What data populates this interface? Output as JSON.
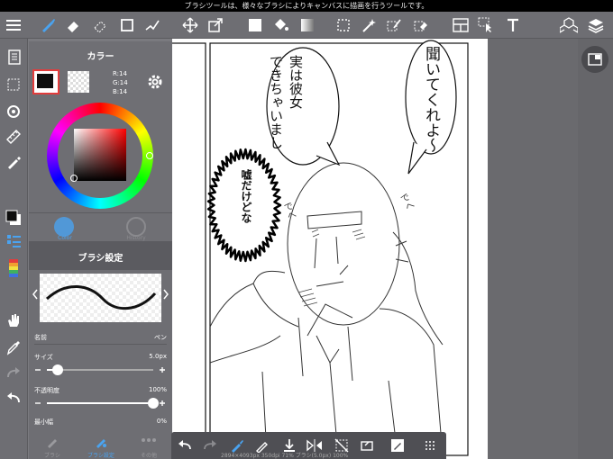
{
  "status_bar": {
    "hint": "ブラシツールは、様々なブラシによりキャンバスに描画を行うツールです。"
  },
  "color_panel": {
    "title": "カラー",
    "rgb": {
      "r": "R:14",
      "g": "G:14",
      "b": "B:14"
    },
    "tabs": [
      "Color",
      "History"
    ]
  },
  "brush_panel": {
    "title": "ブラシ設定",
    "name_label": "名前",
    "name_value": "ペン",
    "size_label": "サイズ",
    "size_value": "5.0px",
    "opacity_label": "不透明度",
    "opacity_value": "100%",
    "min_width_label": "最小幅",
    "min_width_value": "0%",
    "size_level": 0.1,
    "opacity_level": 1.0,
    "bottom_tabs": [
      "ブラシ",
      "ブラシ設定",
      "その他"
    ]
  },
  "canvas": {
    "bubble_right": "聞いてくれよ〜",
    "bubble_middle_col1": "実は彼女",
    "bubble_middle_col2": "できちゃいまし",
    "burst_text": "嘘だけどな",
    "sfx_left": "でへ",
    "sfx_right": "でへ",
    "status_text": "2894×4093px 350dpi 71% ブラシ(5.0px) 100%"
  },
  "colors": {
    "toolbar": "#6e6e73",
    "panel": "#6e6e73",
    "accent_blue": "#4aa3f0",
    "selected_red": "#e23c3c",
    "main_color": "#0e0e0e"
  }
}
